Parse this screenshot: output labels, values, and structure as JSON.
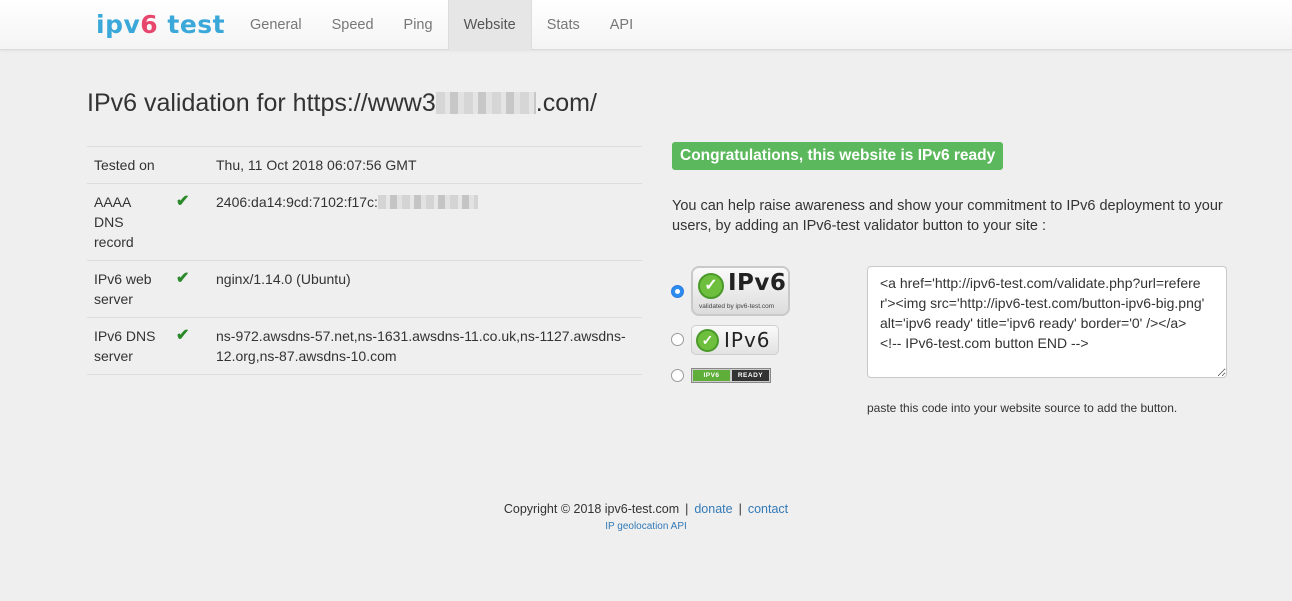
{
  "brand": {
    "part1": "ipv",
    "part2": "6",
    "part3": " test"
  },
  "nav": {
    "items": [
      {
        "label": "General"
      },
      {
        "label": "Speed"
      },
      {
        "label": "Ping"
      },
      {
        "label": "Website",
        "active": true
      },
      {
        "label": "Stats"
      },
      {
        "label": "API"
      }
    ]
  },
  "title": {
    "prefix": "IPv6 validation for https://www3",
    "suffix": ".com/"
  },
  "results": {
    "rows": [
      {
        "label": "Tested on",
        "check": "",
        "value": "Thu, 11 Oct 2018 06:07:56 GMT"
      },
      {
        "label": "AAAA DNS record",
        "check": "✔",
        "value": "2406:da14:9cd:7102:f17c:"
      },
      {
        "label": "IPv6 web server",
        "check": "✔",
        "value": "nginx/1.14.0 (Ubuntu)"
      },
      {
        "label": "IPv6 DNS server",
        "check": "✔",
        "value": "ns-972.awsdns-57.net,ns-1631.awsdns-11.co.uk,ns-1127.awsdns-12.org,ns-87.awsdns-10.com"
      }
    ]
  },
  "status": {
    "congrats": "Congratulations, this website is IPv6 ready",
    "color": "#5cb85c"
  },
  "awareness_text": "You can help raise awareness and show your commitment to IPv6 deployment to your users, by adding an IPv6-test validator button to your site :",
  "buttons": {
    "big": {
      "label": "IPv6",
      "sub": "validated by ipv6-test.com",
      "selected": true
    },
    "medium": {
      "label": "IPv6",
      "selected": false
    },
    "small": {
      "left": "IPV6",
      "right": "READY",
      "selected": false
    }
  },
  "code": "<a href='http://ipv6-test.com/validate.php?url=referer'><img src='http://ipv6-test.com/button-ipv6-big.png' alt='ipv6 ready' title='ipv6 ready' border='0' /></a>\n<!-- IPv6-test.com button END -->",
  "paste_note": "paste this code into your website source to add the button.",
  "footer": {
    "copyright": "Copyright © 2018 ipv6-test.com",
    "donate": "donate",
    "contact": "contact",
    "geo": "IP geolocation API",
    "sep": "|"
  }
}
